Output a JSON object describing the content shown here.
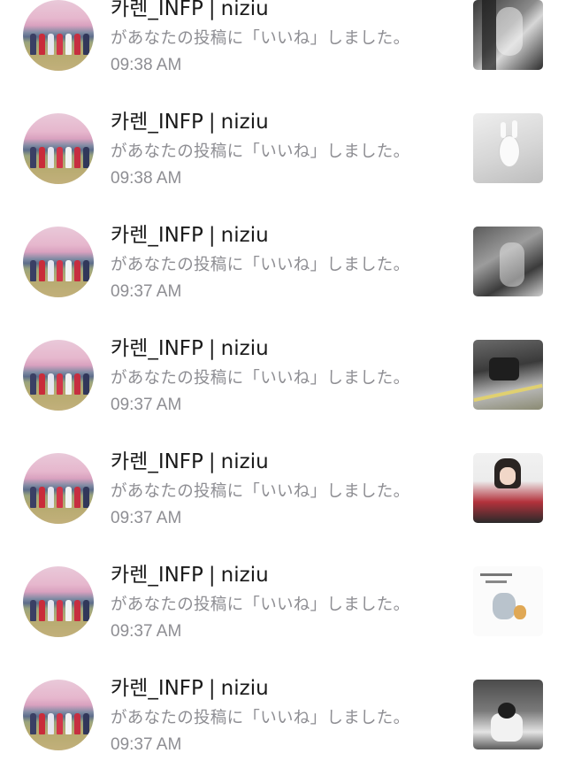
{
  "notifications": [
    {
      "username": "카렌_INFP",
      "separator": "|",
      "group": "niziu",
      "message": "があなたの投稿に「いいね」しました。",
      "time": "09:38 AM"
    },
    {
      "username": "카렌_INFP",
      "separator": "|",
      "group": "niziu",
      "message": "があなたの投稿に「いいね」しました。",
      "time": "09:38 AM"
    },
    {
      "username": "카렌_INFP",
      "separator": "|",
      "group": "niziu",
      "message": "があなたの投稿に「いいね」しました。",
      "time": "09:37 AM"
    },
    {
      "username": "카렌_INFP",
      "separator": "|",
      "group": "niziu",
      "message": "があなたの投稿に「いいね」しました。",
      "time": "09:37 AM"
    },
    {
      "username": "카렌_INFP",
      "separator": "|",
      "group": "niziu",
      "message": "があなたの投稿に「いいね」しました。",
      "time": "09:37 AM"
    },
    {
      "username": "카렌_INFP",
      "separator": "|",
      "group": "niziu",
      "message": "があなたの投稿に「いいね」しました。",
      "time": "09:37 AM"
    },
    {
      "username": "카렌_INFP",
      "separator": "|",
      "group": "niziu",
      "message": "があなたの投稿に「いいね」しました。",
      "time": "09:37 AM"
    }
  ],
  "colors": {
    "name_text": "#1a1a1a",
    "secondary_text": "#8e8e93",
    "background": "#ffffff"
  },
  "icons": {
    "avatar": "profile-photo-avatar",
    "thumbnail": "liked-post-thumbnail"
  }
}
